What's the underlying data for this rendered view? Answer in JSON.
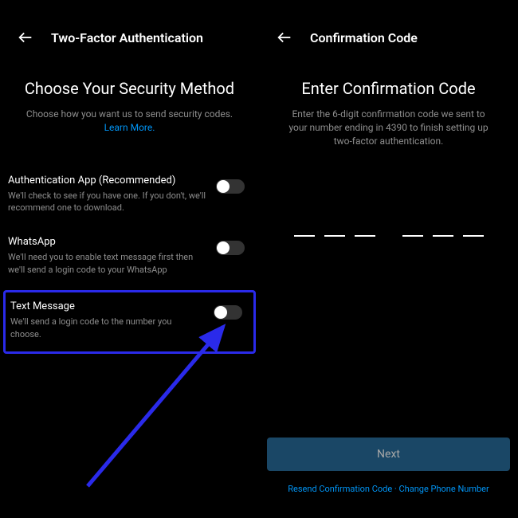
{
  "left": {
    "header_title": "Two-Factor Authentication",
    "section_title": "Choose Your Security Method",
    "section_subtitle_prefix": "Choose how you want us to send security codes. ",
    "learn_more": "Learn More.",
    "options": [
      {
        "title": "Authentication App (Recommended)",
        "desc": "We'll check to see if you have one. If you don't, we'll recommend one to download."
      },
      {
        "title": "WhatsApp",
        "desc": "We'll need you to enable text message first then we'll send a login code to your WhatsApp"
      },
      {
        "title": "Text Message",
        "desc": "We'll send a login code to the number you choose."
      }
    ]
  },
  "right": {
    "header_title": "Confirmation Code",
    "section_title": "Enter Confirmation Code",
    "section_subtitle": "Enter the 6-digit confirmation code we sent to your number ending in 4390 to finish setting up two-factor authentication.",
    "next_label": "Next",
    "resend_label": "Resend Confirmation Code",
    "separator": " · ",
    "change_label": "Change Phone Number"
  },
  "colors": {
    "highlight": "#2a2aea",
    "link": "#0095f6"
  }
}
